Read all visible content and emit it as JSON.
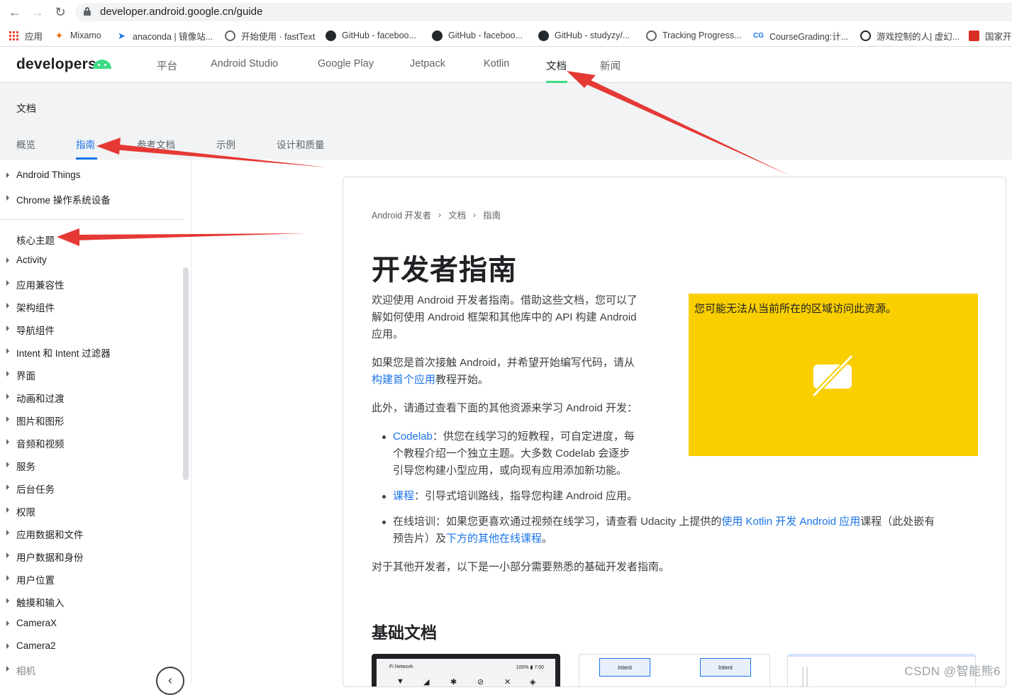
{
  "browser": {
    "url": "developer.android.google.cn/guide",
    "bookmarks": [
      {
        "label": "应用",
        "icon": "apps-grid-icon"
      },
      {
        "label": "Mixamo",
        "icon": "mixamo-icon"
      },
      {
        "label": "anaconda | 镜像站...",
        "icon": "anaconda-icon"
      },
      {
        "label": "开始使用 · fastText",
        "icon": "globe-icon"
      },
      {
        "label": "GitHub - faceboo...",
        "icon": "github-icon"
      },
      {
        "label": "GitHub - faceboo...",
        "icon": "github-icon"
      },
      {
        "label": "GitHub - studyzy/...",
        "icon": "github-icon"
      },
      {
        "label": "Tracking Progress...",
        "icon": "globe-icon"
      },
      {
        "label": "CourseGrading:计...",
        "icon": "coursegrading-icon"
      },
      {
        "label": "游戏控制的人| 虚幻...",
        "icon": "game-icon"
      },
      {
        "label": "国家开",
        "icon": "flag-icon"
      }
    ]
  },
  "header": {
    "logo": "developers",
    "nav": [
      "平台",
      "Android Studio",
      "Google Play",
      "Jetpack",
      "Kotlin",
      "文档",
      "新闻"
    ],
    "active_nav": "文档"
  },
  "subheader": {
    "title": "文档",
    "tabs": [
      "概览",
      "指南",
      "参考文档",
      "示例",
      "设计和质量"
    ],
    "active_tab": "指南"
  },
  "sidebar": {
    "top_items": [
      "Android Things",
      "Chrome 操作系统设备"
    ],
    "section_heading": "核心主题",
    "items": [
      "Activity",
      "应用兼容性",
      "架构组件",
      "导航组件",
      "Intent 和 Intent 过滤器",
      "界面",
      "动画和过渡",
      "图片和图形",
      "音频和视频",
      "服务",
      "后台任务",
      "权限",
      "应用数据和文件",
      "用户数据和身份",
      "用户位置",
      "触摸和输入",
      "CameraX",
      "Camera2",
      "相机"
    ],
    "collapse_glyph": "‹"
  },
  "content": {
    "breadcrumb": [
      "Android 开发者",
      "文档",
      "指南"
    ],
    "title": "开发者指南",
    "intro_lines": [
      "欢迎使用 Android 开发者指南。借助这些文档，您可以了",
      "解如何使用 Android 框架和其他库中的 API 构建 Android",
      "应用。"
    ],
    "p2_line1": "如果您是首次接触 Android，并希望开始编写代码，请从",
    "p2_link": "构建首个应用",
    "p2_tail": "教程开始。",
    "p3": "此外，请通过查看下面的其他资源来学习 Android 开发：",
    "bullet1_link": "Codelab",
    "bullet1_line1": "：供您在线学习的短教程，可自定进度，每",
    "bullet1_line2": "个教程介绍一个独立主题。大多数 Codelab 会逐步",
    "bullet1_line3": "引导您构建小型应用，或向现有应用添加新功能。",
    "bullet2_link": "课程",
    "bullet2_text": "：引导式培训路线，指导您构建 Android 应用。",
    "bullet3_head": "在线培训：如果您更喜欢通过视频在线学习，请查看 Udacity 上提供的",
    "bullet3_link1": "使用 Kotlin 开发 Android 应用",
    "bullet3_mid": "课程（此处嵌有",
    "bullet3_line2_head": "预告片）及",
    "bullet3_link2": "下方的其他在线课程",
    "bullet3_end": "。",
    "p4": "对于其他开发者，以下是一小部分需要熟悉的基础开发者指南。",
    "video_notice": "您可能无法从当前所在的区域访问此资源。",
    "section_title": "基础文档",
    "thumb_phone_network": "Fi Network",
    "thumb_phone_status": "100% ▮ 7:00",
    "thumb_intent_a": "Intent",
    "thumb_intent_b": "Intent"
  },
  "colors": {
    "accent_blue": "#1a73e8",
    "android_green": "#3ddc84",
    "video_yellow": "#f9cf00",
    "annotation_red": "#e53935"
  },
  "watermark": "CSDN @智能熊6"
}
